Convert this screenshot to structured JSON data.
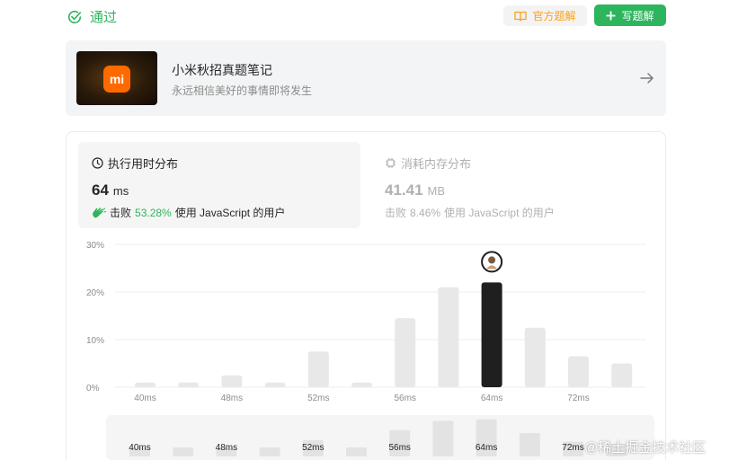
{
  "header": {
    "status": "通过",
    "official_solution": "官方题解",
    "write_solution": "写题解"
  },
  "promo": {
    "title": "小米秋招真题笔记",
    "subtitle": "永远相信美好的事情即将发生",
    "logo_text": "mi"
  },
  "runtime": {
    "tab_label": "执行用时分布",
    "value": "64",
    "unit": "ms",
    "beat_label": "击败",
    "beat_percent": "53.28%",
    "beat_suffix": "使用 JavaScript 的用户"
  },
  "memory": {
    "tab_label": "消耗内存分布",
    "value": "41.41",
    "unit": "MB",
    "beat_label": "击败",
    "beat_percent": "8.46%",
    "beat_suffix": "使用 JavaScript 的用户"
  },
  "chart_data": {
    "type": "bar",
    "y_ticks": [
      "30%",
      "20%",
      "10%",
      "0%"
    ],
    "ylim": [
      0,
      30
    ],
    "categories": [
      "40ms",
      "",
      "48ms",
      "",
      "52ms",
      "",
      "56ms",
      "",
      "64ms",
      "",
      "72ms",
      ""
    ],
    "values": [
      1,
      1,
      2.5,
      1,
      7.5,
      1,
      14.5,
      21,
      22,
      12.5,
      6.5,
      5
    ],
    "highlight_index": 8,
    "x_tick_labels": [
      "40ms",
      "48ms",
      "52ms",
      "56ms",
      "64ms",
      "72ms"
    ],
    "overview_labels": [
      "40ms",
      "48ms",
      "52ms",
      "56ms",
      "64ms",
      "72ms"
    ],
    "colors": {
      "bar": "#e8e8e8",
      "highlight": "#1f1f1f",
      "grid": "#ececec",
      "axis_text": "#8c8c8c"
    }
  },
  "watermark": "@稀土掘金技术社区",
  "colors": {
    "accent_green": "#2db55d",
    "accent_orange": "#ffa116"
  }
}
